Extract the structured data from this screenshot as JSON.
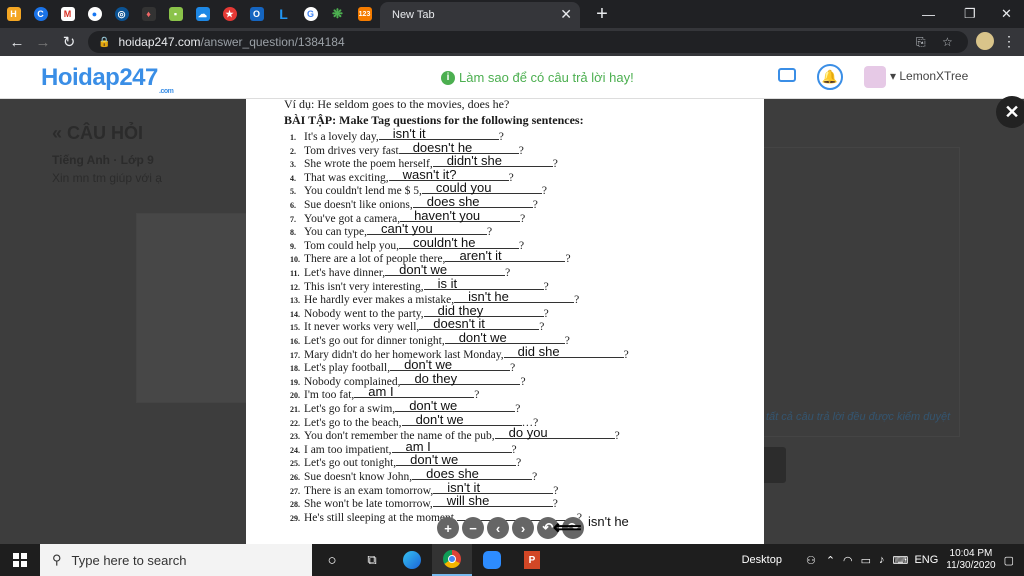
{
  "browser": {
    "active_tab_title": "New Tab",
    "url_host": "hoidap247.com",
    "url_path": "/answer_question/1384184"
  },
  "site": {
    "logo": "Hoidap247",
    "logo_suffix": ".com",
    "tip": "Làm sao để có câu trả lời hay!",
    "username": "LemonXTree"
  },
  "background": {
    "title": "CÂU HỎI",
    "subject": "Tiếng Anh · Lớp 9",
    "text": "Xin mn tm giúp với ạ",
    "note": "tất cả câu trả lời đều được kiểm duyệt"
  },
  "worksheet": {
    "example": "Ví dụ:          He seldom goes to the movies, does he?",
    "heading": "BÀI TẬP: Make Tag questions for the following sentences:",
    "questions": [
      {
        "n": "1.",
        "text": "It's a lovely day,",
        "end": "?",
        "ans": "isn't it"
      },
      {
        "n": "2.",
        "text": "Tom drives very fast",
        "end": "?",
        "ans": "doesn't he"
      },
      {
        "n": "3.",
        "text": "She wrote the poem herself,",
        "end": "?",
        "ans": "didn't she"
      },
      {
        "n": "4.",
        "text": "That was exciting,",
        "end": "?",
        "ans": "wasn't it?"
      },
      {
        "n": "5.",
        "text": "You couldn't lend me $ 5,",
        "end": "?",
        "ans": "could you"
      },
      {
        "n": "6.",
        "text": "Sue doesn't like onions,",
        "end": "?",
        "ans": "does she"
      },
      {
        "n": "7.",
        "text": "You've got a camera,",
        "end": "?",
        "ans": "haven't you"
      },
      {
        "n": "8.",
        "text": "You can type,",
        "end": "?",
        "ans": "can't you"
      },
      {
        "n": "9.",
        "text": "Tom could help you,",
        "end": "?",
        "ans": "couldn't he"
      },
      {
        "n": "10.",
        "text": "There are a lot of people there,",
        "end": "?",
        "ans": "aren't it"
      },
      {
        "n": "11.",
        "text": "Let's have dinner,",
        "end": "?",
        "ans": "don't  we"
      },
      {
        "n": "12.",
        "text": "This isn't very interesting,",
        "end": "?",
        "ans": "is it"
      },
      {
        "n": "13.",
        "text": "He hardly ever makes a mistake,",
        "end": "?",
        "ans": "isn't he"
      },
      {
        "n": "14.",
        "text": "Nobody went to the party,",
        "end": "?",
        "ans": "did they"
      },
      {
        "n": "15.",
        "text": "It never works very well,",
        "end": "?",
        "ans": "doesn't it"
      },
      {
        "n": "16.",
        "text": "Let's go out for dinner tonight,",
        "end": "?",
        "ans": "don't we"
      },
      {
        "n": "17.",
        "text": "Mary didn't do her homework last Monday,",
        "end": "?",
        "ans": "did she"
      },
      {
        "n": "18.",
        "text": "Let's play football,",
        "end": "?",
        "ans": "don't we"
      },
      {
        "n": "19.",
        "text": "Nobody complained,",
        "end": "?",
        "ans": "do they"
      },
      {
        "n": "20.",
        "text": "I'm too fat,",
        "end": "?",
        "ans": "am I"
      },
      {
        "n": "21.",
        "text": "Let's go for a swim,",
        "end": "?",
        "ans": "don't we"
      },
      {
        "n": "22.",
        "text": "Let's go to the beach,",
        "end": "…?",
        "ans": "don't we"
      },
      {
        "n": "23.",
        "text": "You don't remember the name of the pub,",
        "end": "?",
        "ans": "do you"
      },
      {
        "n": "24.",
        "text": "I am too impatient,",
        "end": "?",
        "ans": "am I"
      },
      {
        "n": "25.",
        "text": "Let's go out tonight,",
        "end": "?",
        "ans": "don't we"
      },
      {
        "n": "26.",
        "text": "Sue doesn't know John,",
        "end": "?",
        "ans": "does she"
      },
      {
        "n": "27.",
        "text": "There is an exam tomorrow,",
        "end": "?",
        "ans": "isn't it"
      },
      {
        "n": "28.",
        "text": "She won't be late tomorrow,",
        "end": "?",
        "ans": "will she"
      },
      {
        "n": "29.",
        "text": "He's still sleeping at the moment,",
        "end": "?",
        "ans": ""
      }
    ],
    "extra_answer": "isn't he"
  },
  "taskbar": {
    "search_placeholder": "Type here to search",
    "desktop_label": "Desktop",
    "lang": "ENG",
    "time": "10:04 PM",
    "date": "11/30/2020"
  }
}
